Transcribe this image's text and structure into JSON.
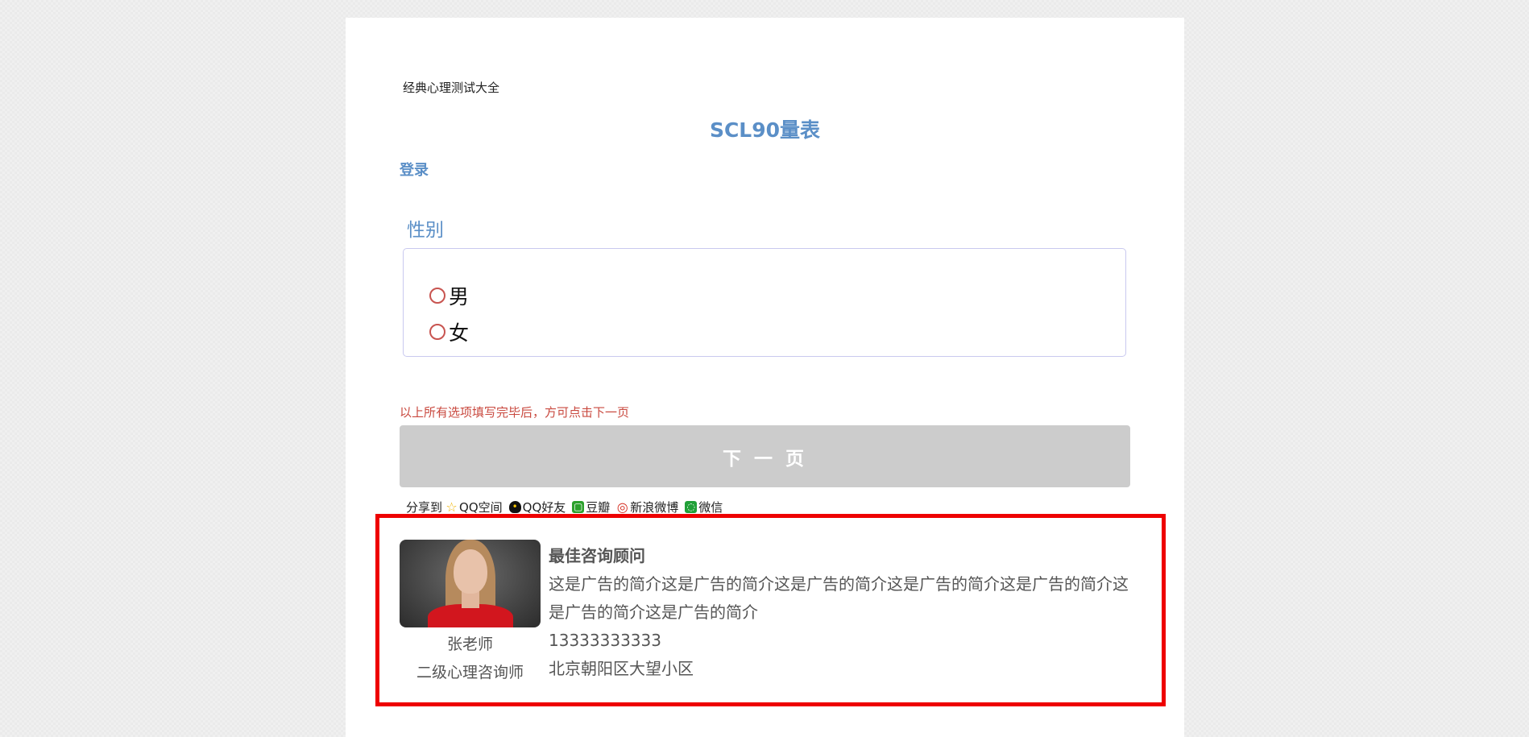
{
  "site": {
    "name": "经典心理测试大全"
  },
  "page": {
    "title": "SCL90量表",
    "login_label": "登录"
  },
  "question": {
    "title": "性别",
    "options": [
      {
        "label": "男"
      },
      {
        "label": "女"
      }
    ]
  },
  "notice": "以上所有选项填写完毕后，方可点击下一页",
  "next_button": "下 一 页",
  "share": {
    "label": "分享到",
    "items": [
      {
        "label": "QQ空间",
        "icon": "star-icon"
      },
      {
        "label": "QQ好友",
        "icon": "qq-penguin-icon"
      },
      {
        "label": "豆瓣",
        "icon": "douban-icon"
      },
      {
        "label": "新浪微博",
        "icon": "weibo-icon"
      },
      {
        "label": "微信",
        "icon": "wechat-icon"
      }
    ]
  },
  "ad": {
    "heading": "最佳咨询顾问",
    "description": "这是广告的简介这是广告的简介这是广告的简介这是广告的简介这是广告的简介这是广告的简介这是广告的简介",
    "phone": "13333333333",
    "address": "北京朝阳区大望小区",
    "advisor_name": "张老师",
    "advisor_role": "二级心理咨询师"
  },
  "colors": {
    "accent": "#5b8fc7",
    "notice": "#c9493f",
    "ad_border": "#ee0000",
    "button_disabled": "#cccccc"
  }
}
